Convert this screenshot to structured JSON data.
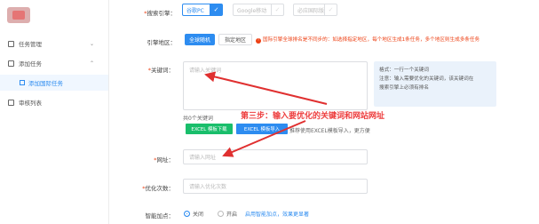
{
  "sidebar": {
    "items": [
      {
        "label": "任务管理",
        "icon": "doc-icon"
      },
      {
        "label": "添加任务",
        "icon": "add-icon"
      },
      {
        "label": "添加国际任务",
        "icon": "globe-icon"
      },
      {
        "label": "审核列表",
        "icon": "check-icon"
      }
    ]
  },
  "form": {
    "engine_label": "搜索引擎：",
    "engines": [
      "谷歌PC",
      "Google移动",
      "必应国际版"
    ],
    "region_label": "引擎地区：",
    "region_options": [
      "全球随机",
      "指定地区"
    ],
    "region_warning": "国际引擎全球排名是不同步的：如选择指定地区，每个地区生成1条任务，多个地区则生成多条任务",
    "keyword_label": "关键词：",
    "keyword_placeholder": "请输入关键词",
    "tip_lines": [
      "格式：一行一个关键词",
      "注意：输入需要优化的关键词，该关键词在",
      "搜索引擎上必须有排名"
    ],
    "keyword_count": "共0个关键词",
    "template_download": "EXCEL 模板下载",
    "template_import": "EXCEL 模板导入",
    "import_hint": "推荐使用EXCEL模板导入，更方便",
    "step_text": "第三步：输入要优化的关键词和网站网址",
    "url_label": "网址：",
    "url_placeholder": "请输入网址",
    "times_label": "优化次数：",
    "times_placeholder": "请输入优化次数",
    "boost_label": "智能加点：",
    "boost_options": [
      "关闭",
      "开启"
    ],
    "boost_link": "启用智能加点，效果更显著"
  },
  "colors": {
    "primary": "#2d8cf0",
    "danger": "#ed4014",
    "success": "#19be6b",
    "arrow": "#e03030"
  }
}
